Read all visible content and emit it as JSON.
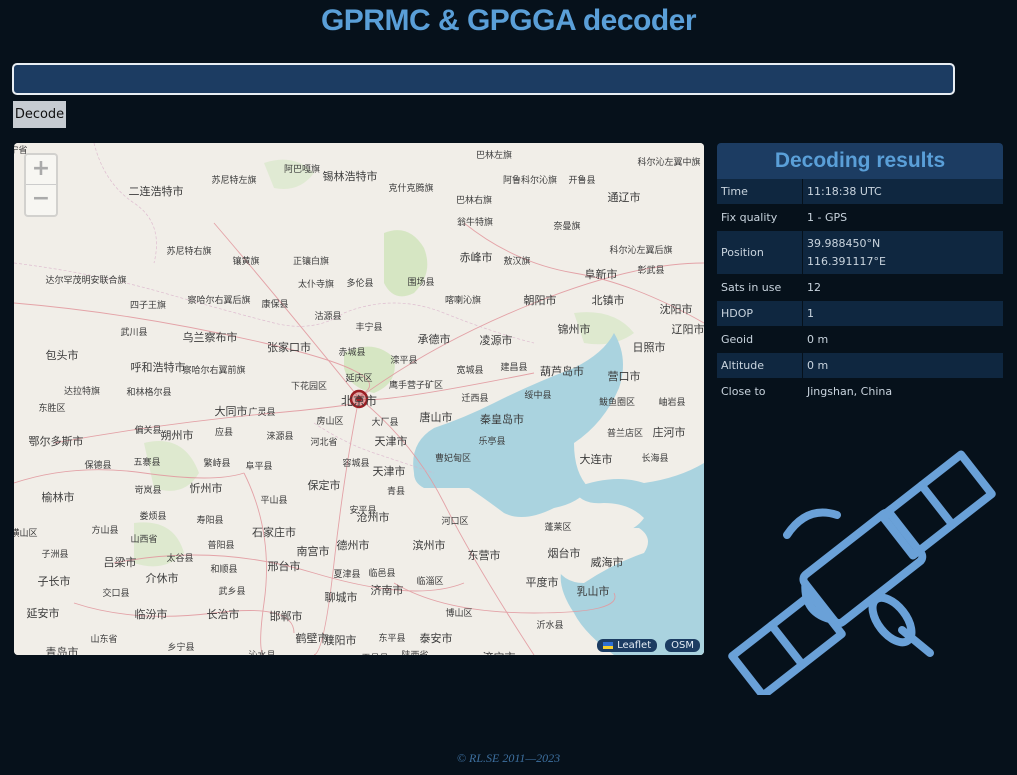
{
  "page": {
    "title": "GPRMC & GPGGA decoder",
    "input": {
      "value": "",
      "placeholder": ""
    },
    "decode_label": "Decode",
    "footer": "©  RL.SE  2011—2023"
  },
  "map": {
    "zoom_in": "+",
    "zoom_out": "−",
    "attribution": {
      "leaflet": "Leaflet",
      "osm": "OSM"
    },
    "marker_label": "北京市",
    "labels": [
      "巴林左旗",
      "科尔沁左翼中旗",
      "二连浩特市",
      "苏尼特左旗",
      "阿巴嘎旗",
      "锡林浩特市",
      "克什克腾旗",
      "阿鲁科尔沁旗",
      "开鲁县",
      "通辽市",
      "巴林右旗",
      "翁牛特旗",
      "奈曼旗",
      "苏尼特右旗",
      "镶黄旗",
      "正镶白旗",
      "赤峰市",
      "敖汉旗",
      "科尔沁左翼后旗",
      "阜新市",
      "彰武县",
      "达尔罕茂明安联合旗",
      "太仆寺旗",
      "多伦县",
      "围场县",
      "察哈尔右翼后旗",
      "康保县",
      "沽源县",
      "喀喇沁旗",
      "朝阳市",
      "北镇市",
      "沈阳市",
      "四子王旗",
      "武川县",
      "乌兰察布市",
      "丰宁县",
      "承德市",
      "凌源市",
      "锦州市",
      "辽阳市",
      "包头市",
      "呼和浩特市",
      "张家口市",
      "赤城县",
      "滦平县",
      "宽城县",
      "建昌县",
      "葫芦岛市",
      "营口市",
      "察哈尔右翼前旗",
      "下花园区",
      "延庆区",
      "鹰手营子矿区",
      "迁西县",
      "绥中县",
      "达拉特旗",
      "和林格尔县",
      "大同市",
      "广灵县",
      "唐山市",
      "秦皇岛市",
      "东胜区",
      "偏关县",
      "朔州市",
      "房山区",
      "大厂县",
      "鲅鱼圈区",
      "岫岩县",
      "鄂尔多斯市",
      "应县",
      "涞源县",
      "河北省",
      "天津市",
      "乐亭县",
      "普兰店区",
      "庄河市",
      "保德县",
      "五寨县",
      "繁峙县",
      "阜平县",
      "容城县",
      "曹妃甸区",
      "大连市",
      "长海县",
      "岢岚县",
      "忻州市",
      "榆林市",
      "保定市",
      "天津市",
      "青县",
      "娄烦县",
      "平山县",
      "安平县",
      "沧州市",
      "河口区",
      "蓬莱区",
      "横山区",
      "方山县",
      "寿阳县",
      "石家庄市",
      "山西省",
      "子洲县",
      "吕梁市",
      "太谷县",
      "普阳县",
      "南宫市",
      "德州市",
      "滨州市",
      "东营市",
      "烟台市",
      "威海市",
      "子长市",
      "介休市",
      "和顺县",
      "邢台市",
      "夏津县",
      "临邑县",
      "临淄区",
      "平度市",
      "交口县",
      "武乡县",
      "聊城市",
      "济南市",
      "乳山市",
      "延安市",
      "临汾市",
      "长治市",
      "邯郸市",
      "博山区",
      "山东省",
      "乡宁县",
      "沁水县",
      "鹤壁市",
      "濮阳市",
      "东平县",
      "泰安市",
      "沂水县",
      "青岛市",
      "陕西省",
      "平邑县",
      "济宁市",
      "日照市",
      "辽宁省"
    ]
  },
  "results": {
    "heading": "Decoding results",
    "rows": [
      {
        "key": "Time",
        "value": "11:18:38 UTC"
      },
      {
        "key": "Fix quality",
        "value": "1 - GPS"
      },
      {
        "key": "Position",
        "value": "39.988450°N",
        "value2": "116.391117°E"
      },
      {
        "key": "Sats in use",
        "value": "12"
      },
      {
        "key": "HDOP",
        "value": "1"
      },
      {
        "key": "Geoid",
        "value": "0 m"
      },
      {
        "key": "Altitude",
        "value": "0 m"
      },
      {
        "key": "Close to",
        "value": "Jingshan, China"
      }
    ]
  },
  "colors": {
    "background": "#06111b",
    "accent": "#5a9fd8",
    "panel": "#1c3c62",
    "row_dark": "#0f2740",
    "sea": "#aad3df",
    "marker": "#c0282d"
  },
  "icons": {
    "satellite": "satellite-icon",
    "marker": "location-marker-icon",
    "flag": "ukraine-flag-icon"
  }
}
